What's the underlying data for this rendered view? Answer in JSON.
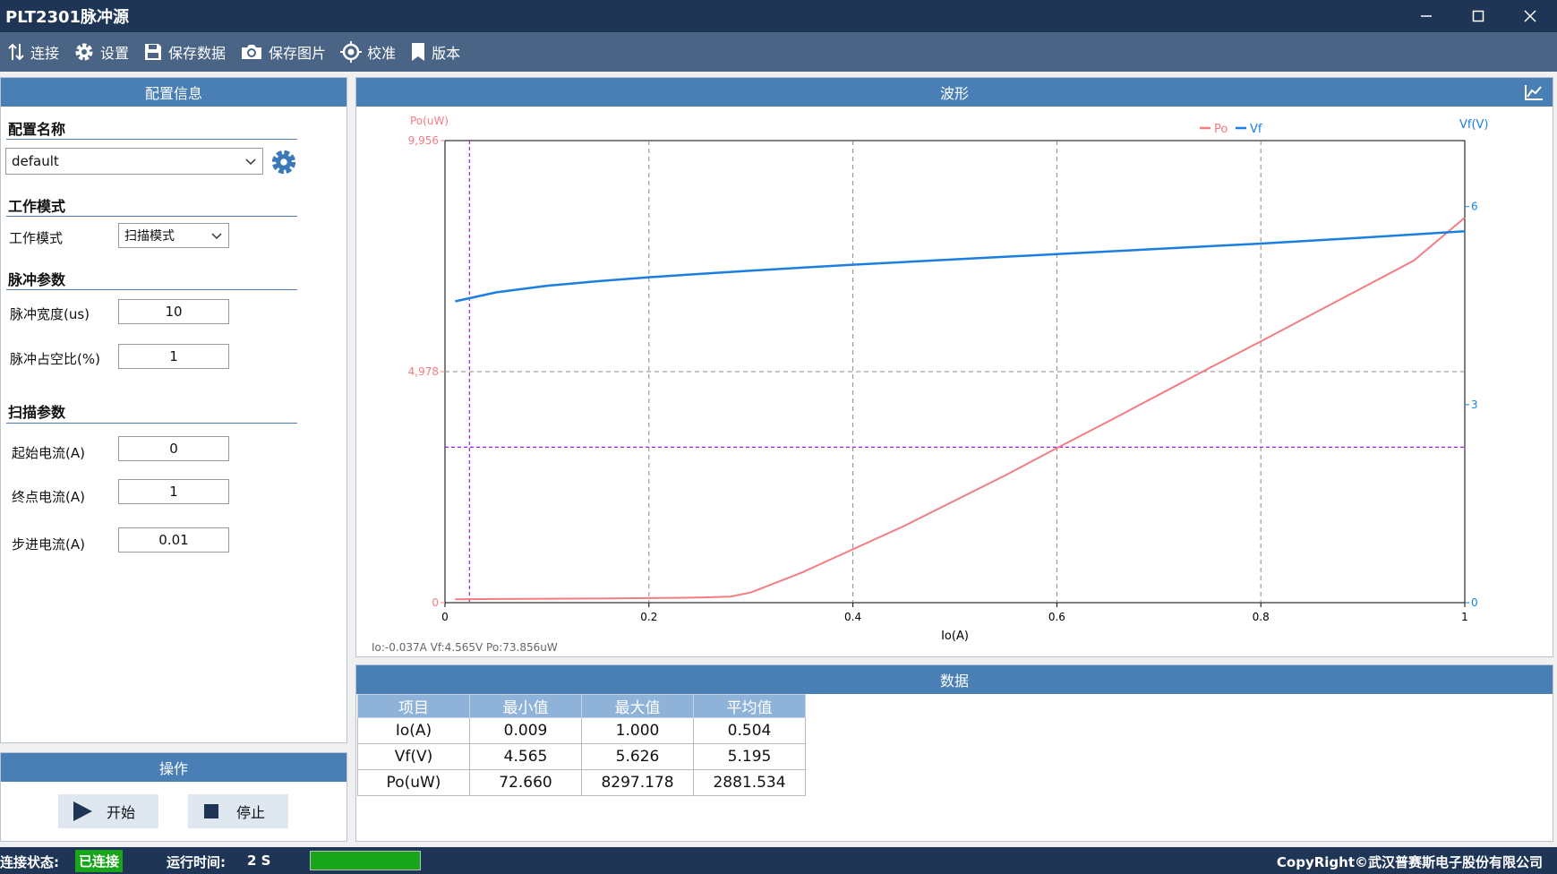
{
  "window": {
    "title": "PLT2301脉冲源"
  },
  "toolbar": {
    "connect": "连接",
    "settings": "设置",
    "save_data": "保存数据",
    "save_image": "保存图片",
    "calibrate": "校准",
    "version": "版本"
  },
  "config_panel": {
    "header": "配置信息",
    "config_name_title": "配置名称",
    "config_name_value": "default",
    "work_mode_title": "工作模式",
    "work_mode_label": "工作模式",
    "work_mode_value": "扫描模式",
    "pulse_title": "脉冲参数",
    "pulse_width_label": "脉冲宽度(us)",
    "pulse_width_value": "10",
    "duty_label": "脉冲占空比(%)",
    "duty_value": "1",
    "scan_title": "扫描参数",
    "start_label": "起始电流(A)",
    "start_value": "0",
    "end_label": "终点电流(A)",
    "end_value": "1",
    "step_label": "步进电流(A)",
    "step_value": "0.01"
  },
  "operation_panel": {
    "header": "操作",
    "start": "开始",
    "stop": "停止"
  },
  "waveform_panel": {
    "header": "波形",
    "cursor_readout": "Io:-0.037A Vf:4.565V Po:73.856uW"
  },
  "data_panel": {
    "header": "数据",
    "columns": [
      "项目",
      "最小值",
      "最大值",
      "平均值"
    ],
    "rows": [
      [
        "Io(A)",
        "0.009",
        "1.000",
        "0.504"
      ],
      [
        "Vf(V)",
        "4.565",
        "5.626",
        "5.195"
      ],
      [
        "Po(uW)",
        "72.660",
        "8297.178",
        "2881.534"
      ]
    ]
  },
  "status": {
    "conn_label": "连接状态:",
    "conn_value": "已连接",
    "runtime_label": "运行时间:",
    "runtime_value": "2 S",
    "progress": 1.0,
    "copyright": "CopyRight©武汉普赛斯电子股份有限公司"
  },
  "colors": {
    "po": "#f47c82",
    "vf": "#1a7fe0",
    "cursor": "#a020f0",
    "connected": "#19a519"
  },
  "chart_data": {
    "type": "line",
    "xlabel": "Io(A)",
    "ylabel_left": "Po(uW)",
    "ylabel_right": "Vf(V)",
    "xlim": [
      0,
      1
    ],
    "ylim_left": [
      0,
      9956
    ],
    "ylim_right": [
      0,
      7
    ],
    "x_ticks": [
      "0",
      "0.2",
      "0.4",
      "0.6",
      "0.8",
      "1"
    ],
    "y_ticks_left": [
      "0",
      "4,978",
      "9,956"
    ],
    "y_ticks_right": [
      "0",
      "3",
      "6"
    ],
    "legend": [
      "Po",
      "Vf"
    ],
    "legend_position": "top-right",
    "grid": true,
    "cursor": {
      "x": 0.024,
      "y_left": 3350
    },
    "series": [
      {
        "name": "Po",
        "axis": "left",
        "x": [
          0.01,
          0.05,
          0.1,
          0.15,
          0.2,
          0.25,
          0.28,
          0.3,
          0.35,
          0.4,
          0.45,
          0.5,
          0.55,
          0.6,
          0.65,
          0.7,
          0.75,
          0.8,
          0.85,
          0.9,
          0.95,
          1.0
        ],
        "values": [
          73,
          80,
          85,
          90,
          100,
          110,
          130,
          220,
          650,
          1150,
          1650,
          2200,
          2750,
          3330,
          3900,
          4480,
          5060,
          5630,
          6210,
          6790,
          7370,
          8297
        ]
      },
      {
        "name": "Vf",
        "axis": "right",
        "x": [
          0.01,
          0.05,
          0.1,
          0.15,
          0.2,
          0.3,
          0.4,
          0.5,
          0.6,
          0.7,
          0.8,
          0.9,
          1.0
        ],
        "values": [
          4.565,
          4.7,
          4.8,
          4.87,
          4.93,
          5.03,
          5.12,
          5.2,
          5.28,
          5.36,
          5.44,
          5.53,
          5.626
        ]
      }
    ]
  }
}
